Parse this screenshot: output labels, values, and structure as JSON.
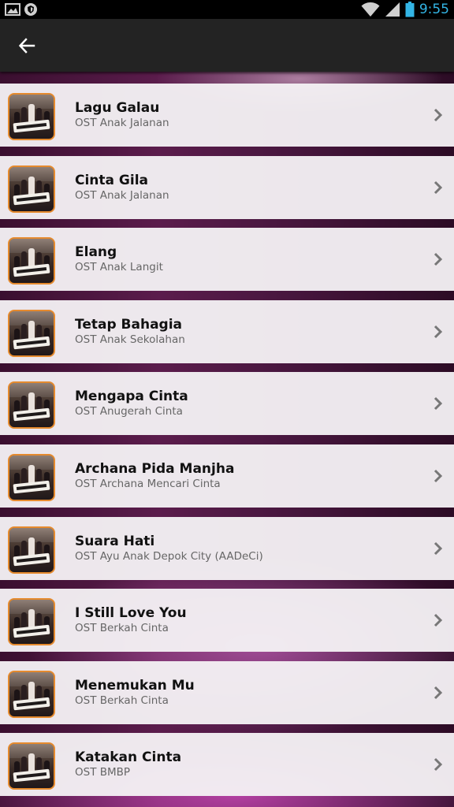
{
  "status_bar": {
    "time": "9:55",
    "icons": [
      "image-icon",
      "shield-icon",
      "wifi-icon",
      "signal-icon",
      "battery-icon"
    ],
    "clock_color": "#33b5e5"
  },
  "app_bar": {
    "back_icon": "arrow-left-icon",
    "background": "#232323"
  },
  "accent": {
    "thumb_border": "#e58a2e",
    "list_background": "#5b1c4c"
  },
  "songs": [
    {
      "title": "Lagu Galau",
      "subtitle": "OST Anak Jalanan"
    },
    {
      "title": "Cinta Gila",
      "subtitle": "OST Anak Jalanan"
    },
    {
      "title": "Elang",
      "subtitle": "OST Anak Langit"
    },
    {
      "title": "Tetap Bahagia",
      "subtitle": "OST Anak Sekolahan"
    },
    {
      "title": "Mengapa Cinta",
      "subtitle": "OST Anugerah Cinta"
    },
    {
      "title": "Archana Pida Manjha",
      "subtitle": "OST Archana Mencari Cinta"
    },
    {
      "title": "Suara Hati",
      "subtitle": "OST Ayu Anak Depok City (AADeCi)"
    },
    {
      "title": "I Still Love You",
      "subtitle": "OST Berkah Cinta"
    },
    {
      "title": "Menemukan Mu",
      "subtitle": "OST Berkah Cinta"
    },
    {
      "title": "Katakan Cinta",
      "subtitle": "OST BMBP"
    }
  ]
}
